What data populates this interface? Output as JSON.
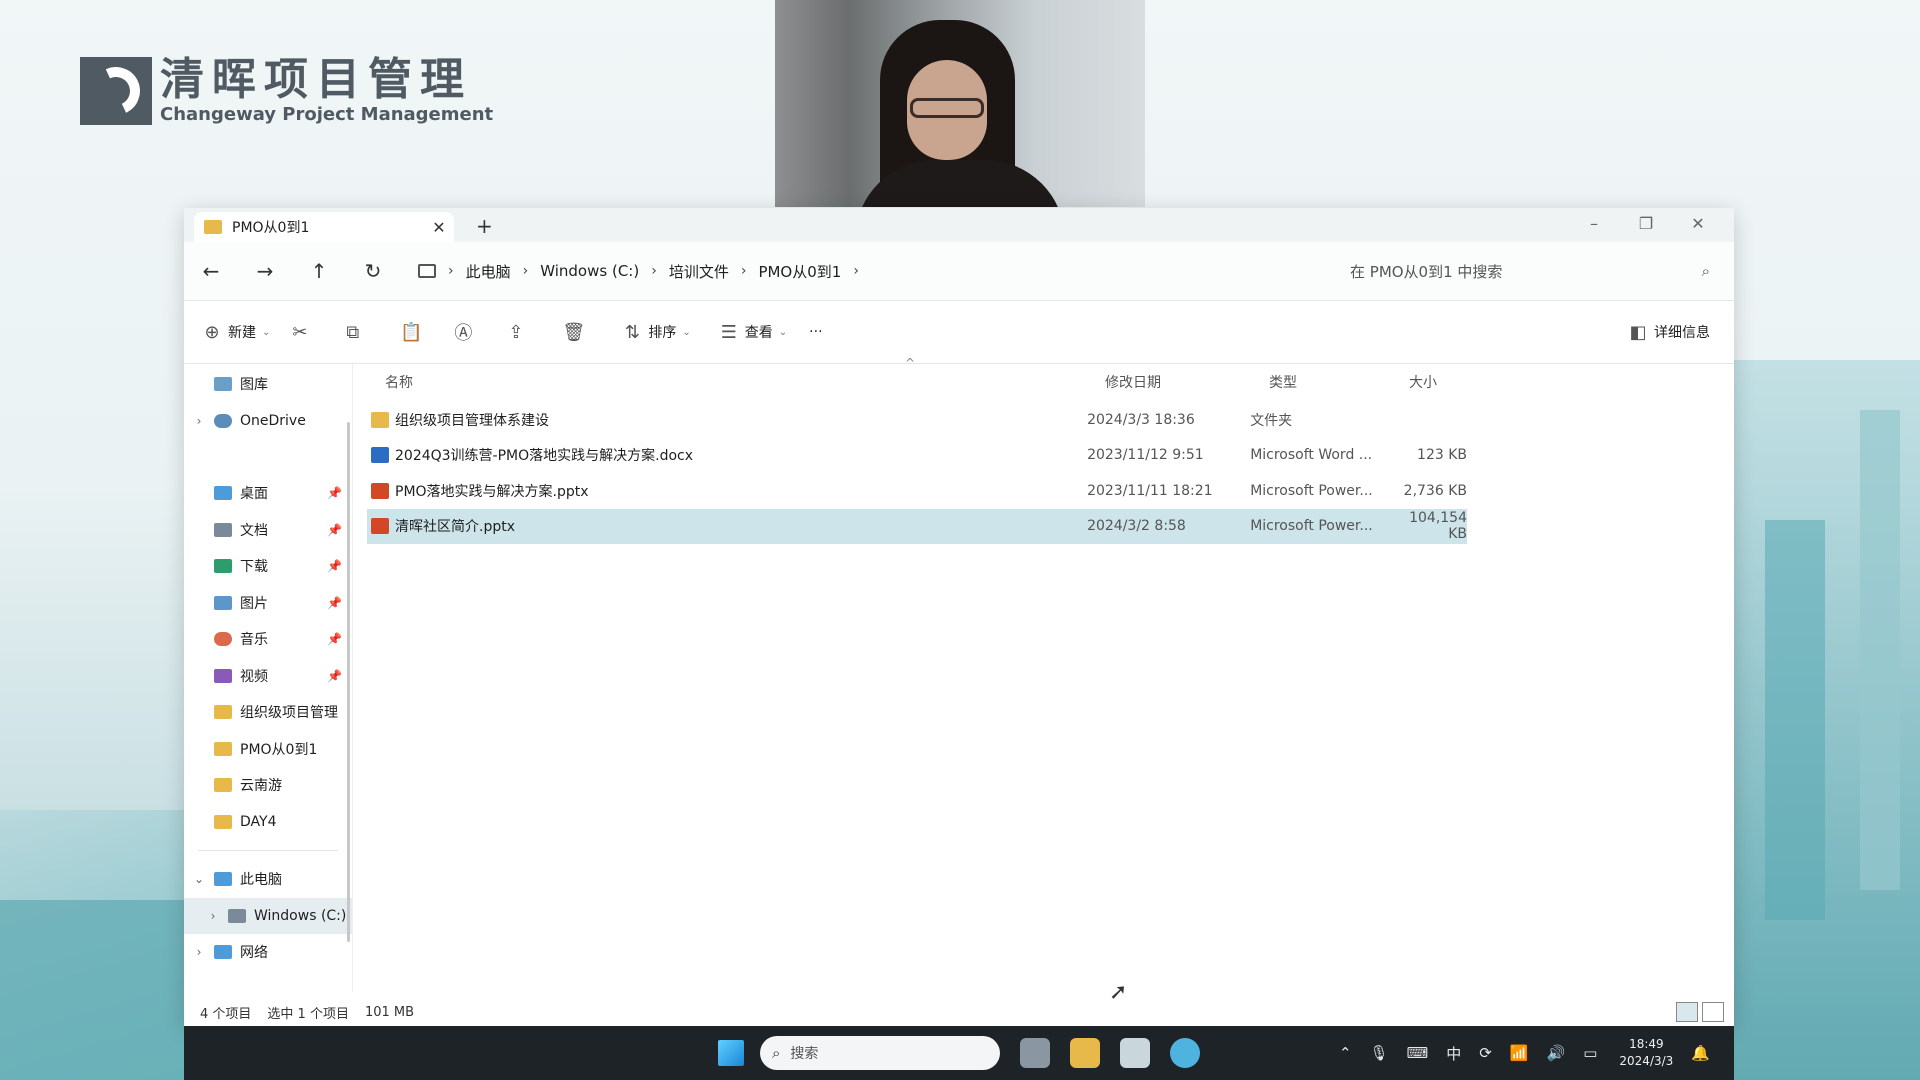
{
  "logo": {
    "cn": "清晖项目管理",
    "en": "Changeway Project Management"
  },
  "tab": {
    "title": "PMO从0到1",
    "close": "✕",
    "add": "+"
  },
  "window_controls": {
    "minimize": "–",
    "maximize": "❐",
    "close": "✕"
  },
  "address": {
    "crumbs": [
      "此电脑",
      "Windows (C:)",
      "培训文件",
      "PMO从0到1"
    ],
    "search_placeholder": "在 PMO从0到1 中搜索"
  },
  "toolbar": {
    "new": "新建",
    "sort": "排序",
    "view": "查看",
    "more": "···",
    "details": "详细信息"
  },
  "sidebar": {
    "top": [
      {
        "label": "图库",
        "icon": "gallery-icon",
        "color": "#6aa0c8"
      },
      {
        "label": "OneDrive",
        "icon": "cloud-icon",
        "color": "#5a8db8"
      }
    ],
    "quick": [
      {
        "label": "桌面",
        "icon": "desktop-icon",
        "color": "#4d9bd8",
        "pinned": true
      },
      {
        "label": "文档",
        "icon": "document-icon",
        "color": "#7a8a9a",
        "pinned": true
      },
      {
        "label": "下载",
        "icon": "download-icon",
        "color": "#2f9c6e",
        "pinned": true
      },
      {
        "label": "图片",
        "icon": "picture-icon",
        "color": "#5c97c9",
        "pinned": true
      },
      {
        "label": "音乐",
        "icon": "music-icon",
        "color": "#d96a4a",
        "pinned": true
      },
      {
        "label": "视频",
        "icon": "video-icon",
        "color": "#8a5ab8",
        "pinned": true
      },
      {
        "label": "组织级项目管理",
        "icon": "folder-icon",
        "color": "#e7b84a",
        "pinned": false
      },
      {
        "label": "PMO从0到1",
        "icon": "folder-icon",
        "color": "#e7b84a",
        "pinned": false
      },
      {
        "label": "云南游",
        "icon": "folder-icon",
        "color": "#e7b84a",
        "pinned": false
      },
      {
        "label": "DAY4",
        "icon": "folder-icon",
        "color": "#e7b84a",
        "pinned": false
      }
    ],
    "bottom": [
      {
        "label": "此电脑",
        "icon": "pc-icon",
        "color": "#4d9bd8",
        "expanded": true
      },
      {
        "label": "Windows (C:)",
        "icon": "drive-icon",
        "color": "#7a8a9a"
      },
      {
        "label": "网络",
        "icon": "network-icon",
        "color": "#4d9bd8"
      }
    ],
    "pin_glyph": "📌"
  },
  "filelist": {
    "headers": {
      "name": "名称",
      "date": "修改日期",
      "type": "类型",
      "size": "大小"
    },
    "rows": [
      {
        "name": "组织级项目管理体系建设",
        "date": "2024/3/3 18:36",
        "type": "文件夹",
        "size": "",
        "icon_color": "#e7b84a",
        "selected": false
      },
      {
        "name": "2024Q3训练营-PMO落地实践与解决方案.docx",
        "date": "2023/11/12 9:51",
        "type": "Microsoft Word ...",
        "size": "123 KB",
        "icon_color": "#2b6cc4",
        "selected": false
      },
      {
        "name": "PMO落地实践与解决方案.pptx",
        "date": "2023/11/11 18:21",
        "type": "Microsoft Power...",
        "size": "2,736 KB",
        "icon_color": "#d24726",
        "selected": false
      },
      {
        "name": "清晖社区简介.pptx",
        "date": "2024/3/2 8:58",
        "type": "Microsoft Power...",
        "size": "104,154 KB",
        "icon_color": "#d24726",
        "selected": true
      }
    ]
  },
  "status": {
    "count": "4 个项目",
    "selected": "选中 1 个项目",
    "size": "101 MB"
  },
  "taskbar": {
    "search_placeholder": "搜索",
    "ime": "中",
    "time": "18:49",
    "date": "2024/3/3"
  }
}
